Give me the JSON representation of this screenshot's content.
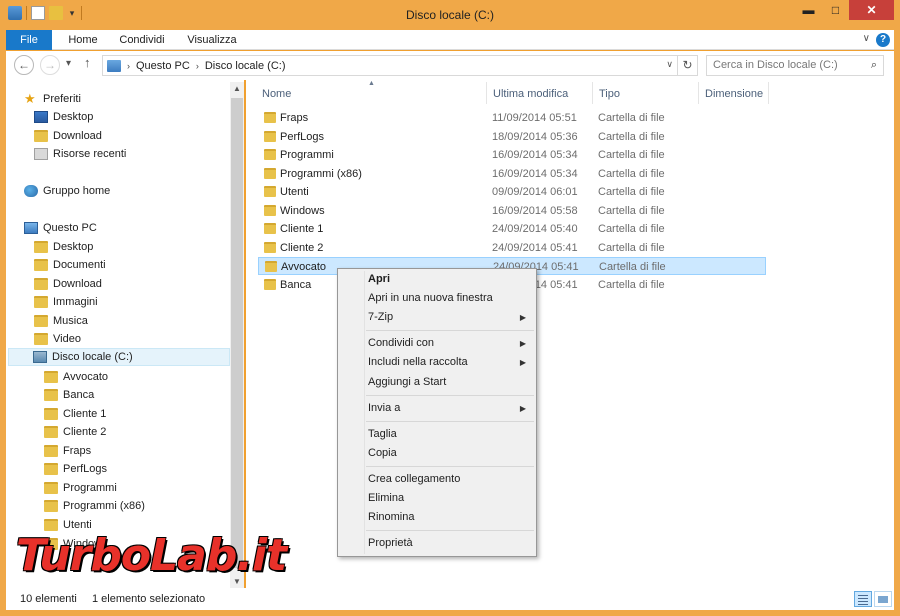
{
  "window": {
    "title": "Disco locale (C:)",
    "close_label": "✕",
    "min_label": "▬",
    "max_label": "□"
  },
  "ribbon": {
    "tabs": [
      "File",
      "Home",
      "Condividi",
      "Visualizza"
    ],
    "help_label": "?"
  },
  "address": {
    "crumbs": [
      "Questo PC",
      "Disco locale (C:)"
    ],
    "search_placeholder": "Cerca in Disco locale (C:)"
  },
  "nav": {
    "items": [
      {
        "label": "Preferiti",
        "icon": "star-icon"
      },
      {
        "label": "Desktop",
        "icon": "desktop-icon"
      },
      {
        "label": "Download",
        "icon": "download-folder-icon"
      },
      {
        "label": "Risorse recenti",
        "icon": "recent-places-icon"
      },
      {
        "label": "Gruppo home",
        "icon": "homegroup-icon"
      },
      {
        "label": "Questo PC",
        "icon": "computer-icon"
      },
      {
        "label": "Desktop",
        "icon": "desktop-folder-icon"
      },
      {
        "label": "Documenti",
        "icon": "documents-folder-icon"
      },
      {
        "label": "Download",
        "icon": "download-folder-icon"
      },
      {
        "label": "Immagini",
        "icon": "pictures-folder-icon"
      },
      {
        "label": "Musica",
        "icon": "music-folder-icon"
      },
      {
        "label": "Video",
        "icon": "videos-folder-icon"
      },
      {
        "label": "Disco locale (C:)",
        "icon": "drive-icon"
      },
      {
        "label": "Avvocato",
        "icon": "folder-icon"
      },
      {
        "label": "Banca",
        "icon": "folder-icon"
      },
      {
        "label": "Cliente 1",
        "icon": "folder-icon"
      },
      {
        "label": "Cliente 2",
        "icon": "folder-icon"
      },
      {
        "label": "Fraps",
        "icon": "folder-icon"
      },
      {
        "label": "PerfLogs",
        "icon": "folder-icon"
      },
      {
        "label": "Programmi",
        "icon": "folder-icon"
      },
      {
        "label": "Programmi (x86)",
        "icon": "folder-icon"
      },
      {
        "label": "Utenti",
        "icon": "folder-icon"
      },
      {
        "label": "Windows",
        "icon": "folder-icon"
      }
    ]
  },
  "columns": {
    "name": "Nome",
    "modified": "Ultima modifica",
    "type": "Tipo",
    "size": "Dimensione"
  },
  "files": [
    {
      "name": "Fraps",
      "date": "11/09/2014 05:51",
      "type": "Cartella di file"
    },
    {
      "name": "PerfLogs",
      "date": "18/09/2014 05:36",
      "type": "Cartella di file"
    },
    {
      "name": "Programmi",
      "date": "16/09/2014 05:34",
      "type": "Cartella di file"
    },
    {
      "name": "Programmi (x86)",
      "date": "16/09/2014 05:34",
      "type": "Cartella di file"
    },
    {
      "name": "Utenti",
      "date": "09/09/2014 06:01",
      "type": "Cartella di file"
    },
    {
      "name": "Windows",
      "date": "16/09/2014 05:58",
      "type": "Cartella di file"
    },
    {
      "name": "Cliente 1",
      "date": "24/09/2014 05:40",
      "type": "Cartella di file"
    },
    {
      "name": "Cliente 2",
      "date": "24/09/2014 05:41",
      "type": "Cartella di file"
    },
    {
      "name": "Avvocato",
      "date": "24/09/2014 05:41",
      "type": "Cartella di file"
    },
    {
      "name": "Banca",
      "date": "24/09/2014 05:41",
      "type": "Cartella di file"
    }
  ],
  "context_menu": {
    "open": "Apri",
    "open_new_window": "Apri in una nuova finestra",
    "sevenzip": "7-Zip",
    "share_with": "Condividi con",
    "include_in_library": "Includi nella raccolta",
    "pin_to_start": "Aggiungi a Start",
    "send_to": "Invia a",
    "cut": "Taglia",
    "copy": "Copia",
    "create_shortcut": "Crea collegamento",
    "delete": "Elimina",
    "rename": "Rinomina",
    "properties": "Proprietà"
  },
  "status": {
    "item_count": "10 elementi",
    "selected": "1 elemento selezionato"
  },
  "watermark": "TurboLab.it"
}
